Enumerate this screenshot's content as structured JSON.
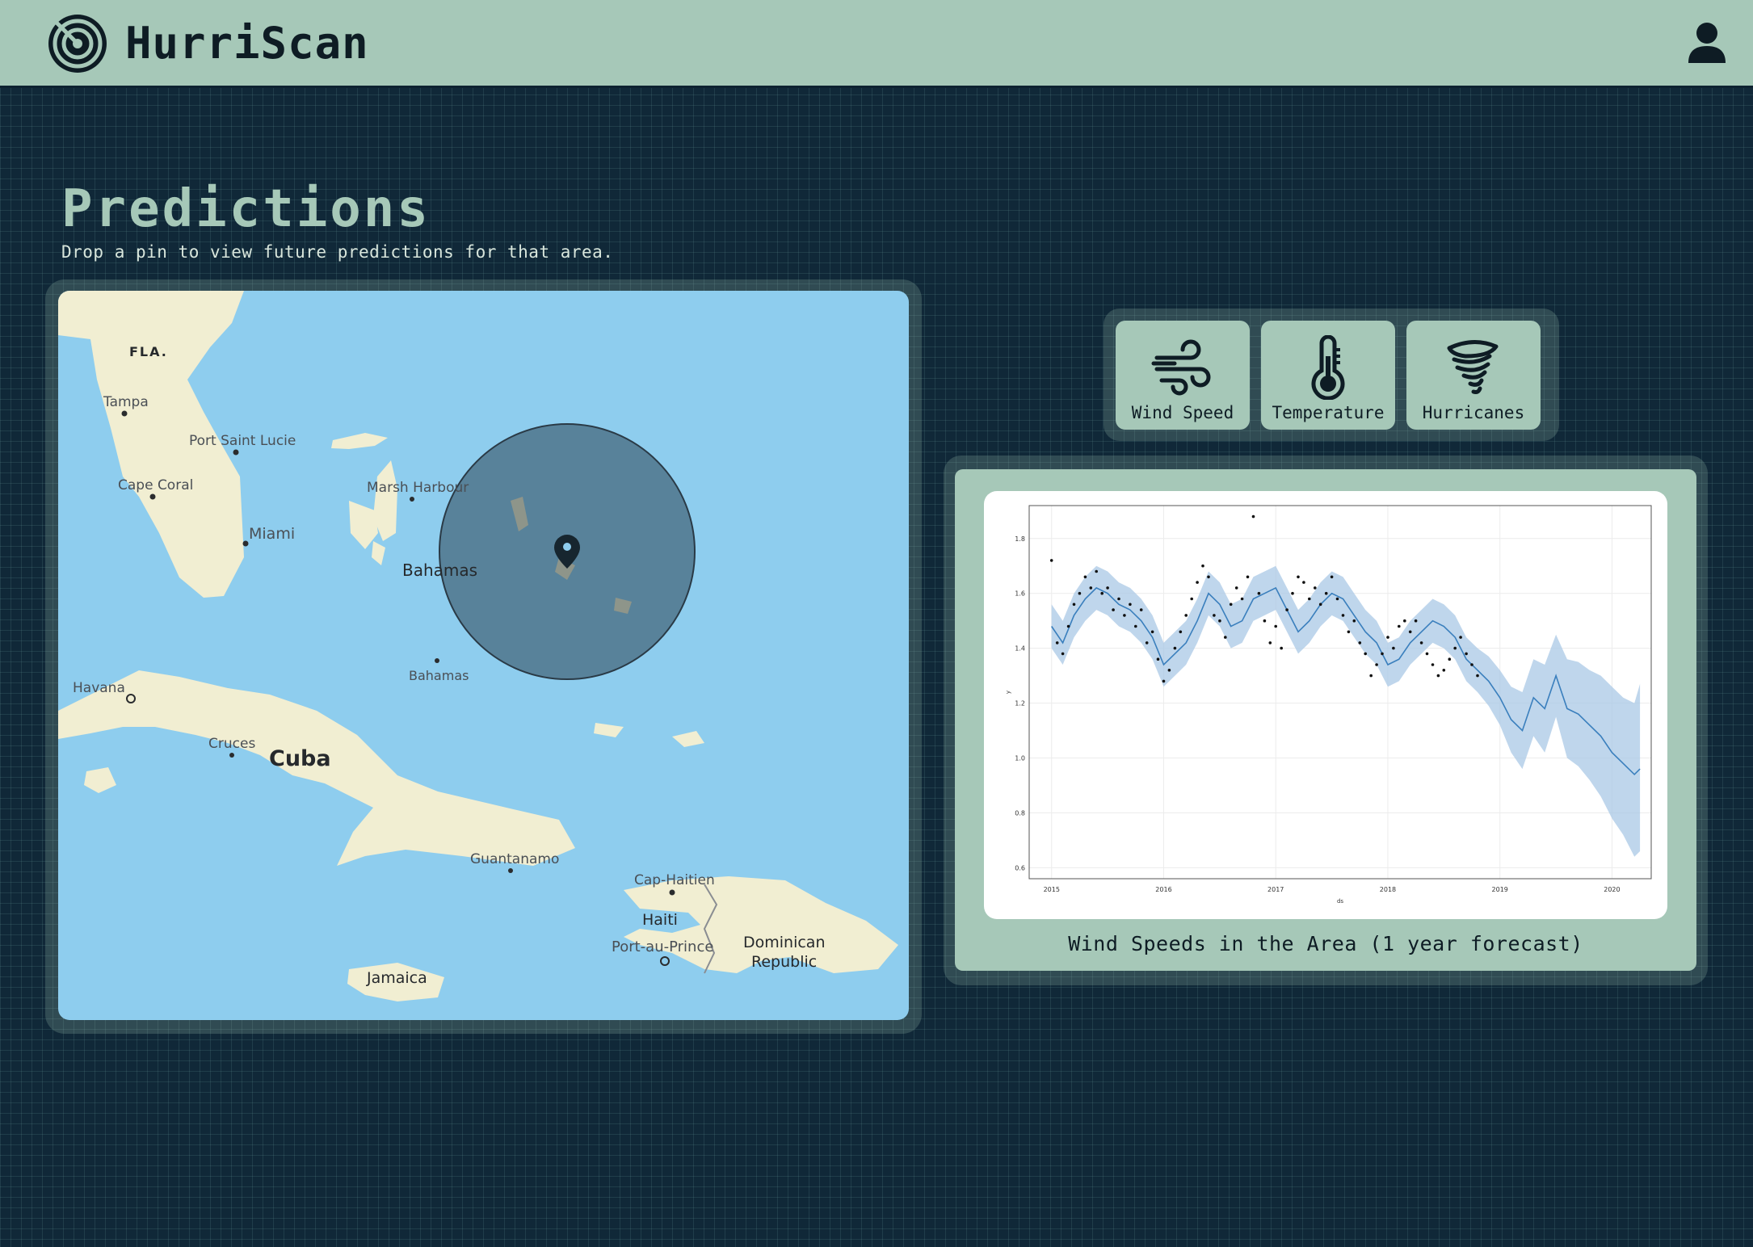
{
  "app": {
    "title": "HurriScan"
  },
  "page": {
    "title": "Predictions",
    "subtitle": "Drop a pin to view future predictions for that area."
  },
  "map": {
    "labels": {
      "fla": "FLA.",
      "tampa": "Tampa",
      "port_saint_lucie": "Port Saint Lucie",
      "cape_coral": "Cape Coral",
      "miami": "Miami",
      "marsh_harbour": "Marsh Harbour",
      "bahamas": "Bahamas",
      "bahamas_small": "Bahamas",
      "havana": "Havana",
      "cruces": "Cruces",
      "cuba": "Cuba",
      "guantanamo": "Guantanamo",
      "cap_haitien": "Cap-Haitien",
      "haiti": "Haiti",
      "port_au_prince": "Port-au-Prince",
      "dominican": "Dominican",
      "republic": "Republic",
      "jamaica": "Jamaica"
    }
  },
  "metrics": [
    {
      "label": "Wind Speed",
      "icon": "wind-icon"
    },
    {
      "label": "Temperature",
      "icon": "thermometer-icon"
    },
    {
      "label": "Hurricanes",
      "icon": "hurricane-icon"
    }
  ],
  "chart": {
    "caption": "Wind Speeds in the Area (1 year forecast)"
  },
  "chart_data": {
    "type": "line",
    "title": "",
    "xlabel": "ds",
    "ylabel": "y",
    "xlim": [
      2014.8,
      2020.35
    ],
    "ylim": [
      0.56,
      1.92
    ],
    "x_ticks": [
      "2015",
      "2016",
      "2017",
      "2018",
      "2019",
      "2020"
    ],
    "y_ticks": [
      "0.6",
      "0.8",
      "1.0",
      "1.2",
      "1.4",
      "1.6",
      "1.8"
    ],
    "grid": true,
    "series": [
      {
        "kind": "forecast",
        "x": [
          2015.0,
          2015.1,
          2015.2,
          2015.3,
          2015.4,
          2015.5,
          2015.6,
          2015.7,
          2015.8,
          2015.9,
          2016.0,
          2016.1,
          2016.2,
          2016.3,
          2016.4,
          2016.5,
          2016.6,
          2016.7,
          2016.8,
          2016.9,
          2017.0,
          2017.1,
          2017.2,
          2017.3,
          2017.4,
          2017.5,
          2017.6,
          2017.7,
          2017.8,
          2017.9,
          2018.0,
          2018.1,
          2018.2,
          2018.3,
          2018.4,
          2018.5,
          2018.6,
          2018.7,
          2018.8,
          2018.9,
          2019.0,
          2019.1,
          2019.2,
          2019.3,
          2019.4,
          2019.5,
          2019.6,
          2019.7,
          2019.8,
          2019.9,
          2020.0,
          2020.1,
          2020.2,
          2020.25
        ],
        "y": [
          1.48,
          1.42,
          1.52,
          1.58,
          1.62,
          1.6,
          1.56,
          1.54,
          1.5,
          1.44,
          1.34,
          1.38,
          1.42,
          1.5,
          1.6,
          1.56,
          1.48,
          1.5,
          1.58,
          1.6,
          1.62,
          1.54,
          1.46,
          1.5,
          1.56,
          1.6,
          1.58,
          1.52,
          1.46,
          1.42,
          1.34,
          1.36,
          1.42,
          1.46,
          1.5,
          1.48,
          1.44,
          1.36,
          1.32,
          1.28,
          1.22,
          1.14,
          1.1,
          1.22,
          1.18,
          1.3,
          1.18,
          1.16,
          1.12,
          1.08,
          1.02,
          0.98,
          0.94,
          0.96
        ],
        "upper": [
          1.56,
          1.5,
          1.6,
          1.66,
          1.7,
          1.68,
          1.64,
          1.62,
          1.58,
          1.52,
          1.42,
          1.46,
          1.5,
          1.58,
          1.68,
          1.64,
          1.56,
          1.58,
          1.66,
          1.68,
          1.7,
          1.62,
          1.54,
          1.58,
          1.64,
          1.68,
          1.66,
          1.6,
          1.54,
          1.5,
          1.42,
          1.44,
          1.5,
          1.54,
          1.58,
          1.56,
          1.52,
          1.44,
          1.4,
          1.37,
          1.32,
          1.26,
          1.24,
          1.36,
          1.34,
          1.45,
          1.36,
          1.35,
          1.32,
          1.3,
          1.26,
          1.22,
          1.2,
          1.27
        ],
        "lower": [
          1.4,
          1.34,
          1.44,
          1.5,
          1.54,
          1.52,
          1.48,
          1.46,
          1.42,
          1.36,
          1.26,
          1.3,
          1.34,
          1.42,
          1.52,
          1.48,
          1.4,
          1.42,
          1.5,
          1.52,
          1.54,
          1.46,
          1.38,
          1.42,
          1.48,
          1.52,
          1.5,
          1.44,
          1.38,
          1.34,
          1.26,
          1.28,
          1.34,
          1.38,
          1.42,
          1.4,
          1.36,
          1.28,
          1.24,
          1.19,
          1.12,
          1.02,
          0.96,
          1.08,
          1.02,
          1.15,
          1.0,
          0.97,
          0.92,
          0.86,
          0.78,
          0.72,
          0.64,
          0.66
        ]
      },
      {
        "kind": "observed",
        "x": [
          2015.0,
          2015.05,
          2015.1,
          2015.15,
          2015.2,
          2015.25,
          2015.3,
          2015.35,
          2015.4,
          2015.45,
          2015.5,
          2015.55,
          2015.6,
          2015.65,
          2015.7,
          2015.75,
          2015.8,
          2015.85,
          2015.9,
          2015.95,
          2016.0,
          2016.05,
          2016.1,
          2016.15,
          2016.2,
          2016.25,
          2016.3,
          2016.35,
          2016.4,
          2016.45,
          2016.5,
          2016.55,
          2016.6,
          2016.65,
          2016.7,
          2016.75,
          2016.8,
          2016.85,
          2016.9,
          2016.95,
          2017.0,
          2017.05,
          2017.1,
          2017.15,
          2017.2,
          2017.25,
          2017.3,
          2017.35,
          2017.4,
          2017.45,
          2017.5,
          2017.55,
          2017.6,
          2017.65,
          2017.7,
          2017.75,
          2017.8,
          2017.85,
          2017.9,
          2017.95,
          2018.0,
          2018.05,
          2018.1,
          2018.15,
          2018.2,
          2018.25,
          2018.3,
          2018.35,
          2018.4,
          2018.45,
          2018.5,
          2018.55,
          2018.6,
          2018.65,
          2018.7,
          2018.75,
          2018.8
        ],
        "y": [
          1.72,
          1.42,
          1.38,
          1.48,
          1.56,
          1.6,
          1.66,
          1.62,
          1.68,
          1.6,
          1.62,
          1.54,
          1.58,
          1.52,
          1.56,
          1.48,
          1.54,
          1.42,
          1.46,
          1.36,
          1.28,
          1.32,
          1.4,
          1.46,
          1.52,
          1.58,
          1.64,
          1.7,
          1.66,
          1.52,
          1.5,
          1.44,
          1.56,
          1.62,
          1.58,
          1.66,
          1.88,
          1.6,
          1.5,
          1.42,
          1.48,
          1.4,
          1.54,
          1.6,
          1.66,
          1.64,
          1.58,
          1.62,
          1.56,
          1.6,
          1.66,
          1.58,
          1.52,
          1.46,
          1.5,
          1.42,
          1.38,
          1.3,
          1.34,
          1.38,
          1.44,
          1.4,
          1.48,
          1.5,
          1.46,
          1.5,
          1.42,
          1.38,
          1.34,
          1.3,
          1.32,
          1.36,
          1.4,
          1.44,
          1.38,
          1.34,
          1.3
        ]
      }
    ]
  },
  "colors": {
    "accent": "#a6c8b8",
    "background": "#102838",
    "water": "#8ecdee",
    "land": "#f1eed2",
    "forecast_line": "#3a7fbd",
    "forecast_band": "#a9c8e6"
  }
}
